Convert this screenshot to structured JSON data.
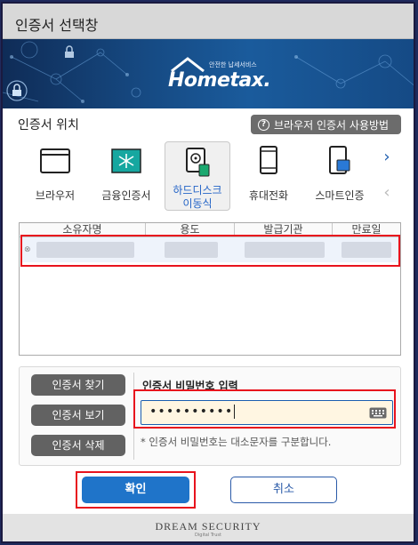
{
  "window": {
    "title": "인증서 선택창"
  },
  "banner": {
    "logo_small": "안전한 납세서비스",
    "logo_big": "Hometax."
  },
  "location": {
    "title": "인증서 위치",
    "help_button": "브라우저 인증서 사용방법"
  },
  "storage": {
    "items": [
      {
        "label": "브라우저",
        "icon": "browser-icon"
      },
      {
        "label": "금융인증서",
        "icon": "financial-cert-icon"
      },
      {
        "label": "하드디스크\n이동식",
        "icon": "hard-disk-icon",
        "selected": true
      },
      {
        "label": "휴대전화",
        "icon": "mobile-phone-icon"
      },
      {
        "label": "스마트인증",
        "icon": "smart-cert-icon"
      }
    ],
    "next_arrow": "›",
    "prev_arrow": "‹"
  },
  "cert_table": {
    "columns": [
      "소유자명",
      "용도",
      "발급기관",
      "만료일"
    ]
  },
  "actions": {
    "find": "인증서 찾기",
    "view": "인증서 보기",
    "delete": "인증서 삭제"
  },
  "password": {
    "label": "인증서 비밀번호 입력",
    "value": "••••••••••",
    "note": "* 인증서 비밀번호는 대소문자를 구분합니다."
  },
  "buttons": {
    "ok": "확인",
    "cancel": "취소"
  },
  "footer": {
    "brand": "DREAM SECURITY",
    "tagline": "Digital Trust"
  },
  "colors": {
    "accent": "#1f74c9",
    "highlight_box": "#e8131d",
    "action_button": "#626262"
  }
}
